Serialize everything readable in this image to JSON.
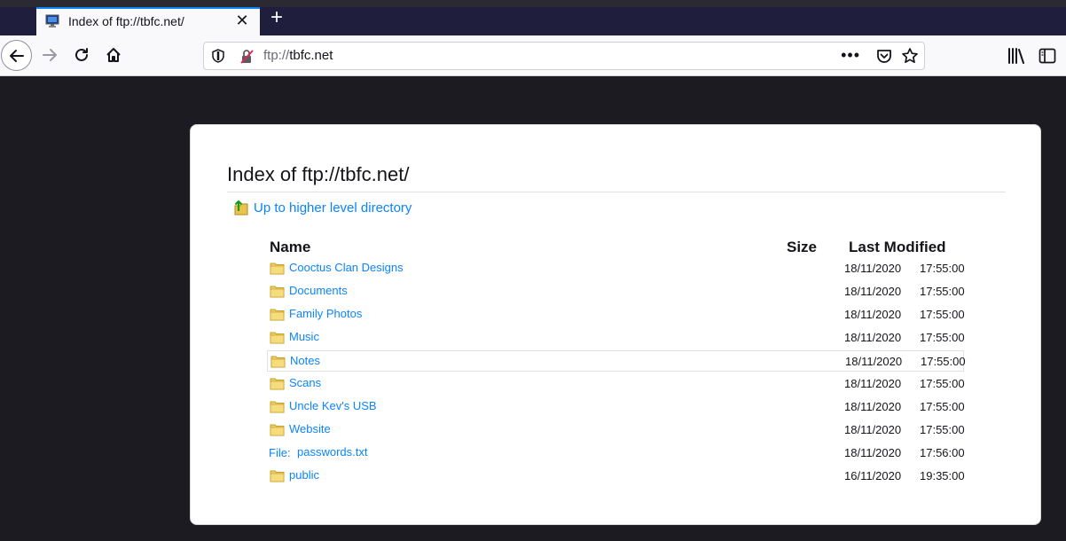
{
  "browser": {
    "tab": {
      "title": "Index of ftp://tbfc.net/"
    },
    "url": {
      "scheme": "ftp://",
      "host": "tbfc.net"
    }
  },
  "page": {
    "heading": "Index of ftp://tbfc.net/",
    "up_link": "Up to higher level directory",
    "columns": {
      "name": "Name",
      "size": "Size",
      "modified": "Last Modified"
    },
    "file_prefix": "File:",
    "entries": [
      {
        "name": "Cooctus Clan Designs",
        "type": "dir",
        "date": "18/11/2020",
        "time": "17:55:00"
      },
      {
        "name": "Documents",
        "type": "dir",
        "date": "18/11/2020",
        "time": "17:55:00"
      },
      {
        "name": "Family Photos",
        "type": "dir",
        "date": "18/11/2020",
        "time": "17:55:00"
      },
      {
        "name": "Music",
        "type": "dir",
        "date": "18/11/2020",
        "time": "17:55:00"
      },
      {
        "name": "Notes",
        "type": "dir",
        "date": "18/11/2020",
        "time": "17:55:00",
        "hovered": true
      },
      {
        "name": "Scans",
        "type": "dir",
        "date": "18/11/2020",
        "time": "17:55:00"
      },
      {
        "name": "Uncle Kev's USB",
        "type": "dir",
        "date": "18/11/2020",
        "time": "17:55:00"
      },
      {
        "name": "Website",
        "type": "dir",
        "date": "18/11/2020",
        "time": "17:55:00"
      },
      {
        "name": "passwords.txt",
        "type": "file",
        "date": "18/11/2020",
        "time": "17:56:00"
      },
      {
        "name": "public",
        "type": "dir",
        "date": "16/11/2020",
        "time": "19:35:00"
      }
    ]
  },
  "colors": {
    "link": "#0a84ff",
    "tab_accent": "#0a84ff",
    "chrome_dark": "#1f1f3d",
    "page_bg": "#1c1b22"
  },
  "icons": [
    "monitor-favicon-icon",
    "close-icon",
    "plus-icon",
    "back-arrow-icon",
    "forward-arrow-icon",
    "reload-icon",
    "home-icon",
    "shield-icon",
    "insecure-lock-icon",
    "more-icon",
    "pocket-icon",
    "star-icon",
    "library-icon",
    "sidebar-icon",
    "up-directory-icon",
    "folder-icon"
  ]
}
